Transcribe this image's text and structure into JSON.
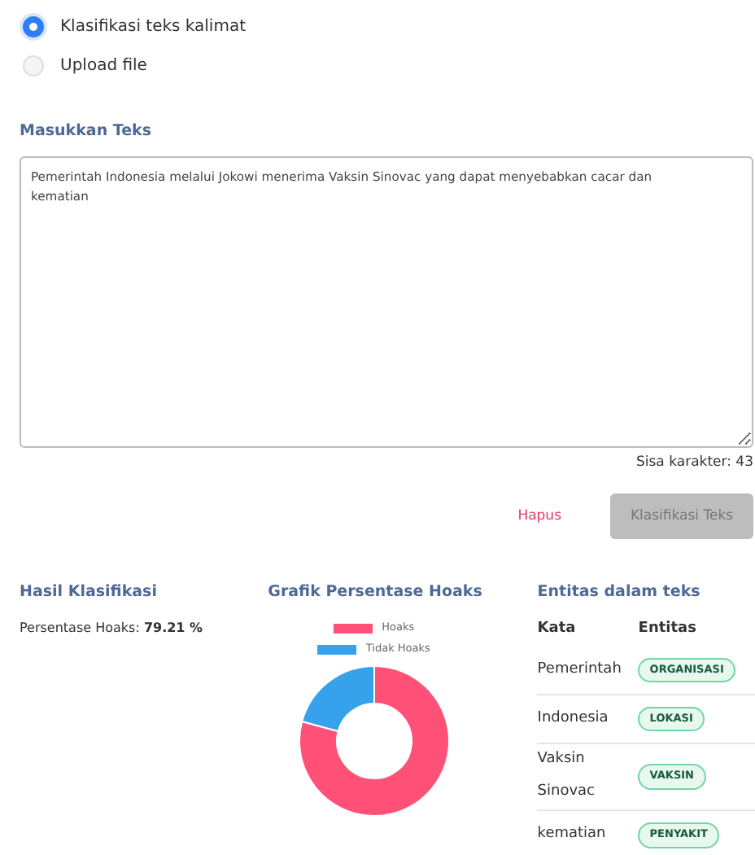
{
  "mode_options": [
    {
      "label": "Klasifikasi teks kalimat",
      "selected": true
    },
    {
      "label": "Upload file",
      "selected": false
    }
  ],
  "input": {
    "heading": "Masukkan Teks",
    "value": "Pemerintah Indonesia melalui Jokowi menerima Vaksin Sinovac yang dapat menyebabkan cacar dan kematian",
    "remaining": "Sisa karakter: 43"
  },
  "buttons": [
    {
      "label": "Hapus",
      "kind": "link",
      "disabled": false
    },
    {
      "label": "Klasifikasi Teks",
      "kind": "button",
      "disabled": true
    }
  ],
  "result": {
    "heading": "Hasil Klasifikasi",
    "label": "Persentase Hoaks:",
    "value": "79.21 %"
  },
  "chart": {
    "heading": "Grafik Persentase Hoaks",
    "chart_data": {
      "type": "donut",
      "categories": [
        "Hoaks",
        "Tidak Hoaks"
      ],
      "values": [
        79.21,
        20.79
      ],
      "colors": [
        "#ff5077",
        "#36a2eb"
      ],
      "legend": "top"
    }
  },
  "entities": {
    "heading": "Entitas dalam teks",
    "columns": [
      "Kata",
      "Entitas"
    ],
    "rows": [
      {
        "word": "Pemerintah",
        "entity": "ORGANISASI"
      },
      {
        "word": "Indonesia",
        "entity": "LOKASI"
      },
      {
        "word": "Vaksin Sinovac",
        "entity": "VAKSIN"
      },
      {
        "word": "kematian",
        "entity": "PENYAKIT"
      }
    ]
  }
}
